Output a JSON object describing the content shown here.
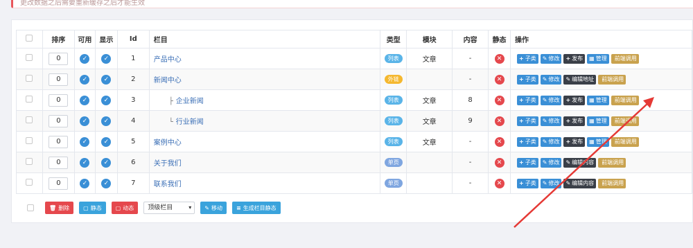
{
  "alert": {
    "text": "更改数据之后需要重新缓存之后才能生效"
  },
  "table": {
    "headers": {
      "sort": "排序",
      "enabled": "可用",
      "show": "显示",
      "id": "Id",
      "column": "栏目",
      "type": "类型",
      "module": "模块",
      "content": "内容",
      "static": "静态",
      "actions": "操作"
    },
    "rows": [
      {
        "sort": "0",
        "id": "1",
        "name": "产品中心",
        "prefix": "",
        "type": "列表",
        "type_color": "blue",
        "module": "文章",
        "content": "-",
        "actions": [
          "子类",
          "修改",
          "发布",
          "管理",
          "前端调用"
        ]
      },
      {
        "sort": "0",
        "id": "2",
        "name": "新闻中心",
        "prefix": "",
        "type": "外链",
        "type_color": "yellow",
        "module": "",
        "content": "-",
        "actions": [
          "子类",
          "修改",
          "编辑地址",
          "前端调用"
        ]
      },
      {
        "sort": "0",
        "id": "3",
        "name": "企业新闻",
        "prefix": "├",
        "type": "列表",
        "type_color": "blue",
        "module": "文章",
        "content": "8",
        "actions": [
          "子类",
          "修改",
          "发布",
          "管理",
          "前端调用"
        ]
      },
      {
        "sort": "0",
        "id": "4",
        "name": "行业新闻",
        "prefix": "└",
        "type": "列表",
        "type_color": "blue",
        "module": "文章",
        "content": "9",
        "actions": [
          "子类",
          "修改",
          "发布",
          "管理",
          "前端调用"
        ]
      },
      {
        "sort": "0",
        "id": "5",
        "name": "案例中心",
        "prefix": "",
        "type": "列表",
        "type_color": "blue",
        "module": "文章",
        "content": "-",
        "actions": [
          "子类",
          "修改",
          "发布",
          "管理",
          "前端调用"
        ]
      },
      {
        "sort": "0",
        "id": "6",
        "name": "关于我们",
        "prefix": "",
        "type": "单页",
        "type_color": "sky",
        "module": "",
        "content": "-",
        "actions": [
          "子类",
          "修改",
          "编辑内容",
          "前端调用"
        ]
      },
      {
        "sort": "0",
        "id": "7",
        "name": "联系我们",
        "prefix": "",
        "type": "单页",
        "type_color": "sky",
        "module": "",
        "content": "-",
        "actions": [
          "子类",
          "修改",
          "编辑内容",
          "前端调用"
        ]
      }
    ]
  },
  "bottom": {
    "delete": "删除",
    "static": "静态",
    "dynamic": "动态",
    "select_value": "顶级栏目",
    "move": "移动",
    "generate": "生成栏目静态"
  },
  "colors": {
    "primary": "#3a8fd6",
    "danger": "#e5484d",
    "dark": "#3a3f48",
    "gold": "#c9a24e",
    "annotation_arrow": "#e53935"
  }
}
